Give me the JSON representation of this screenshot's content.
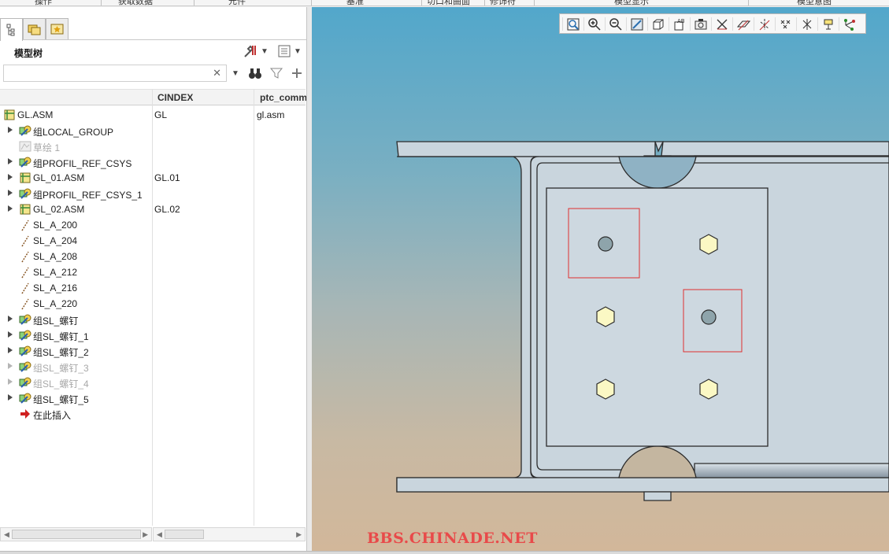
{
  "ribbon": {
    "items": [
      "操作",
      "获取数据",
      "元件",
      "基准",
      "切口和曲面",
      "修饰符",
      "模型显示",
      "模型意图"
    ]
  },
  "left_panel": {
    "title": "模型树",
    "search": {
      "value": "",
      "placeholder": ""
    },
    "columns": [
      "",
      "CINDEX",
      "ptc_comm"
    ],
    "rows": [
      {
        "label": "GL.ASM",
        "cindex": "GL",
        "ptc": "gl.asm",
        "icon": "assembly-icon",
        "level": 0,
        "expand": false,
        "dim": false
      },
      {
        "label": "组LOCAL_GROUP",
        "cindex": "",
        "ptc": "",
        "icon": "group-icon",
        "level": 1,
        "expand": true,
        "dim": false
      },
      {
        "label": "草绘 1",
        "cindex": "",
        "ptc": "",
        "icon": "sketch-icon",
        "level": 1,
        "expand": false,
        "dim": true
      },
      {
        "label": "组PROFIL_REF_CSYS",
        "cindex": "",
        "ptc": "",
        "icon": "group-icon",
        "level": 1,
        "expand": true,
        "dim": false
      },
      {
        "label": "GL_01.ASM",
        "cindex": "GL.01",
        "ptc": "",
        "icon": "assembly-icon",
        "level": 1,
        "expand": true,
        "dim": false
      },
      {
        "label": "组PROFIL_REF_CSYS_1",
        "cindex": "",
        "ptc": "",
        "icon": "group-icon",
        "level": 1,
        "expand": true,
        "dim": false
      },
      {
        "label": "GL_02.ASM",
        "cindex": "GL.02",
        "ptc": "",
        "icon": "assembly-icon",
        "level": 1,
        "expand": true,
        "dim": false
      },
      {
        "label": "SL_A_200",
        "cindex": "",
        "ptc": "",
        "icon": "curve-icon",
        "level": 1,
        "expand": false,
        "dim": false
      },
      {
        "label": "SL_A_204",
        "cindex": "",
        "ptc": "",
        "icon": "curve-icon",
        "level": 1,
        "expand": false,
        "dim": false
      },
      {
        "label": "SL_A_208",
        "cindex": "",
        "ptc": "",
        "icon": "curve-icon",
        "level": 1,
        "expand": false,
        "dim": false
      },
      {
        "label": "SL_A_212",
        "cindex": "",
        "ptc": "",
        "icon": "curve-icon",
        "level": 1,
        "expand": false,
        "dim": false
      },
      {
        "label": "SL_A_216",
        "cindex": "",
        "ptc": "",
        "icon": "curve-icon",
        "level": 1,
        "expand": false,
        "dim": false
      },
      {
        "label": "SL_A_220",
        "cindex": "",
        "ptc": "",
        "icon": "curve-icon",
        "level": 1,
        "expand": false,
        "dim": false
      },
      {
        "label": "组SL_螺钉",
        "cindex": "",
        "ptc": "",
        "icon": "group-icon",
        "level": 1,
        "expand": true,
        "dim": false
      },
      {
        "label": "组SL_螺钉_1",
        "cindex": "",
        "ptc": "",
        "icon": "group-icon",
        "level": 1,
        "expand": true,
        "dim": false
      },
      {
        "label": "组SL_螺钉_2",
        "cindex": "",
        "ptc": "",
        "icon": "group-icon",
        "level": 1,
        "expand": true,
        "dim": false
      },
      {
        "label": "组SL_螺钉_3",
        "cindex": "",
        "ptc": "",
        "icon": "group-icon",
        "level": 1,
        "expand": true,
        "dim": true
      },
      {
        "label": "组SL_螺钉_4",
        "cindex": "",
        "ptc": "",
        "icon": "group-icon",
        "level": 1,
        "expand": true,
        "dim": true
      },
      {
        "label": "组SL_螺钉_5",
        "cindex": "",
        "ptc": "",
        "icon": "group-icon",
        "level": 1,
        "expand": true,
        "dim": false
      },
      {
        "label": "在此插入",
        "cindex": "",
        "ptc": "",
        "icon": "insert-here-icon",
        "level": 1,
        "expand": false,
        "dim": false
      }
    ]
  },
  "viewport": {
    "toolbar": [
      "refit-icon",
      "zoom-in-icon",
      "zoom-out-icon",
      "repaint-icon",
      "display-style-icon",
      "saved-views-icon",
      "view-manager-icon",
      "perspective-icon",
      "datum-planes-icon",
      "datum-axes-icon",
      "datum-points-icon",
      "csys-icon",
      "annotations-icon",
      "spin-center-icon"
    ],
    "watermark": "BBS.CHINADE.NET",
    "colors": {
      "part_fill": "#c9d5dd",
      "bolt_fill": "#fbf8c4",
      "highlight": "#e03030",
      "edge": "#2c2c2c"
    }
  }
}
